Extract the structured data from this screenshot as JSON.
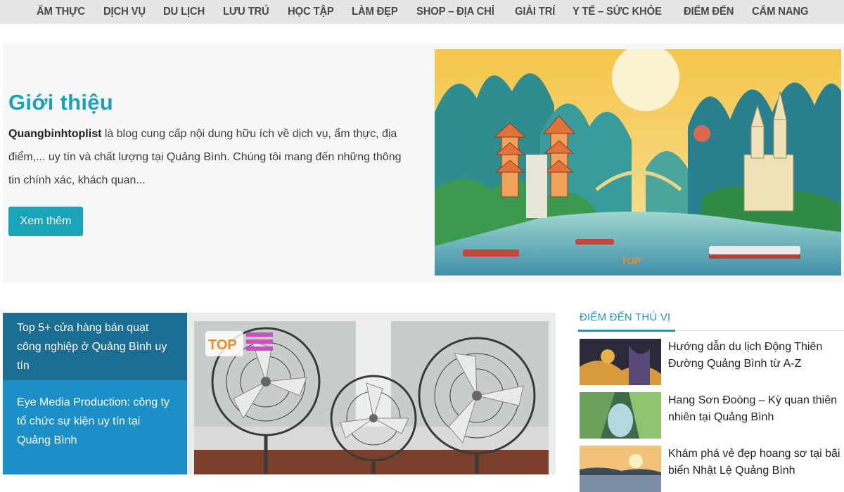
{
  "nav": {
    "items": [
      "ẨM THỰC",
      "DỊCH VỤ",
      "DU LỊCH",
      "LƯU TRÚ",
      "HỌC TẬP",
      "LÀM ĐẸP",
      "SHOP – ĐỊA CHỈ",
      "GIẢI TRÍ",
      "Y TẾ – SỨC KHỎE",
      "ĐIỂM ĐẾN",
      "CẨM NANG"
    ]
  },
  "intro": {
    "title": "Giới thiệu",
    "brand": "Quangbinhtoplist",
    "text": " là blog cung cấp nội dung hữu ích về dịch vụ, ẩm thực, địa điểm,... uy tín và chất lượng tại Quảng Bình. Chúng tôi mang đến những thông tin chính xác, khách quan...",
    "button_label": "Xem thêm",
    "image_logo": "TOP"
  },
  "slider": {
    "items": [
      {
        "label": "Top 5+ cửa hàng bán quạt công nghiệp ở Quảng Bình uy tín"
      },
      {
        "label": "Eye Media Production: công ty tổ chức sự kiện uy tín tại Quảng Bình"
      }
    ],
    "photo_logo": "TOP"
  },
  "sidebar": {
    "heading": "ĐIỂM ĐẾN THÚ VỊ",
    "posts": [
      {
        "title": "Hướng dẫn du lịch Động Thiên Đường Quảng Bình từ A-Z"
      },
      {
        "title": "Hang Sơn Đoòng – Kỳ quan thiên nhiên tại Quảng Bình"
      },
      {
        "title": "Khám phá vẻ đẹp hoang sơ tại bãi biển Nhật Lệ Quảng Bình"
      }
    ]
  },
  "colors": {
    "accent": "#1aa0b8",
    "slider_active": "#1b6d93",
    "slider_normal": "#1d8fc8",
    "sidebar_accent": "#1a95c9"
  }
}
